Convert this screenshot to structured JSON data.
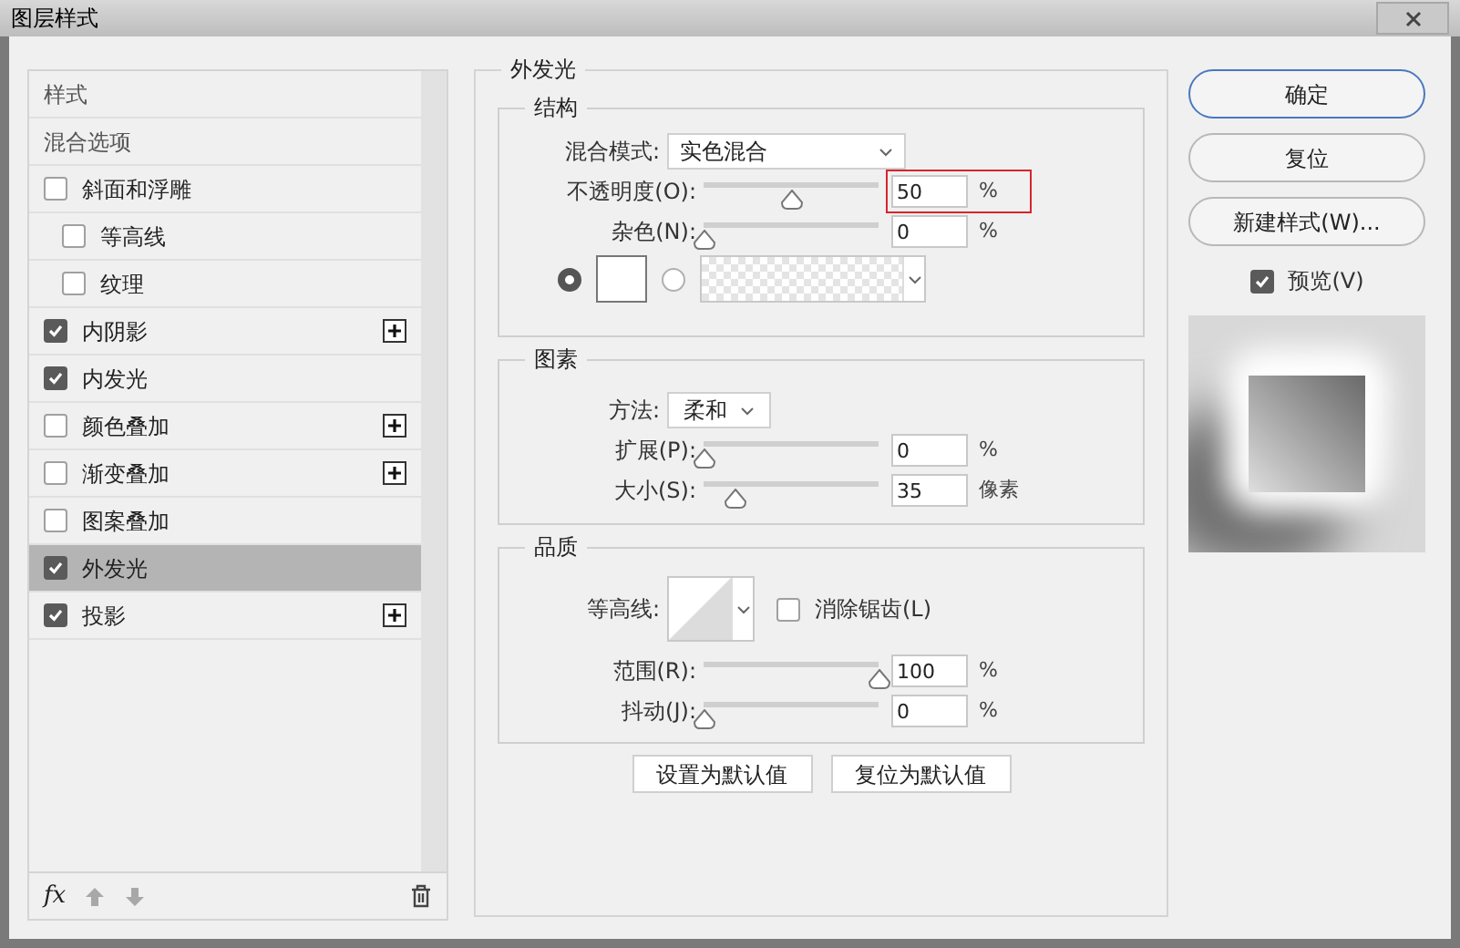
{
  "window": {
    "title": "图层样式"
  },
  "style_list": {
    "items": [
      {
        "kind": "header",
        "label": "样式",
        "selected": false
      },
      {
        "kind": "header",
        "label": "混合选项",
        "selected": false
      },
      {
        "kind": "checkbox",
        "label": "斜面和浮雕",
        "checked": false,
        "selected": false,
        "addable": false,
        "children": [
          {
            "kind": "checkbox",
            "label": "等高线",
            "checked": false,
            "selected": false,
            "addable": false
          },
          {
            "kind": "checkbox",
            "label": "纹理",
            "checked": false,
            "selected": false,
            "addable": false
          }
        ]
      },
      {
        "kind": "checkbox",
        "label": "内阴影",
        "checked": true,
        "selected": false,
        "addable": true
      },
      {
        "kind": "checkbox",
        "label": "内发光",
        "checked": true,
        "selected": false,
        "addable": false
      },
      {
        "kind": "checkbox",
        "label": "颜色叠加",
        "checked": false,
        "selected": false,
        "addable": true
      },
      {
        "kind": "checkbox",
        "label": "渐变叠加",
        "checked": false,
        "selected": false,
        "addable": true
      },
      {
        "kind": "checkbox",
        "label": "图案叠加",
        "checked": false,
        "selected": false,
        "addable": false
      },
      {
        "kind": "checkbox",
        "label": "外发光",
        "checked": true,
        "selected": true,
        "addable": false
      },
      {
        "kind": "checkbox",
        "label": "投影",
        "checked": true,
        "selected": false,
        "addable": true
      }
    ],
    "fx_label": "fx"
  },
  "outer_glow": {
    "title": "外发光",
    "structure": {
      "title": "结构",
      "blend_mode": {
        "label": "混合模式:",
        "value": "实色混合"
      },
      "opacity": {
        "label": "不透明度(O):",
        "level": 0.5,
        "value": "50",
        "unit": "%",
        "highlighted": true
      },
      "noise": {
        "label": "杂色(N):",
        "level": 0,
        "value": "0",
        "unit": "%",
        "highlighted": false
      },
      "fill_options": [
        {
          "kind": "color",
          "selected": true
        },
        {
          "kind": "gradient",
          "selected": false
        }
      ]
    },
    "elements": {
      "title": "图素",
      "method": {
        "label": "方法:",
        "value": "柔和"
      },
      "spread": {
        "label": "扩展(P):",
        "level": 0,
        "value": "0",
        "unit": "%",
        "highlighted": false
      },
      "size": {
        "label": "大小(S):",
        "level": 0.18,
        "value": "35",
        "unit": "像素",
        "highlighted": false
      }
    },
    "quality": {
      "title": "品质",
      "contour": {
        "label": "等高线:"
      },
      "anti_alias": {
        "label": "消除锯齿(L)",
        "checked": false
      },
      "range": {
        "label": "范围(R):",
        "level": 1,
        "value": "100",
        "unit": "%",
        "highlighted": false
      },
      "jitter": {
        "label": "抖动(J):",
        "level": 0,
        "value": "0",
        "unit": "%",
        "highlighted": false
      }
    },
    "buttons": [
      "设置为默认值",
      "复位为默认值"
    ]
  },
  "actions": [
    {
      "label": "确定",
      "primary": true
    },
    {
      "label": "复位",
      "primary": false
    },
    {
      "label": "新建样式(W)...",
      "primary": false
    }
  ],
  "preview": {
    "label": "预览(V)",
    "checked": true
  }
}
